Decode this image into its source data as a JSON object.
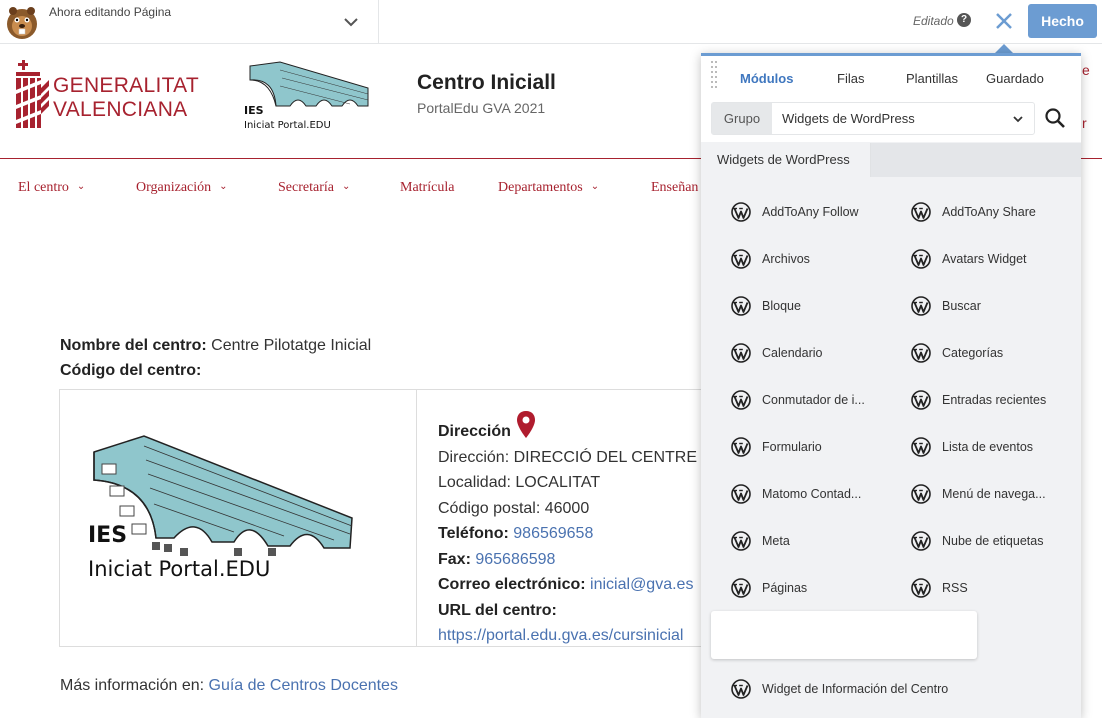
{
  "builder": {
    "editing_label": "Ahora editando Página",
    "status_label": "Editado",
    "help_icon": "help-icon",
    "close_icon": "close-icon",
    "done_label": "Hecho"
  },
  "site": {
    "org_name_line1": "GENERALITAT",
    "org_name_line2": "VALENCIANA",
    "title": "Centro Iniciall",
    "tagline": "PortalEdu GVA 2021",
    "logo_text_line1": "IES",
    "logo_text_line2": "Iniciat Portal.EDU",
    "right_edge_1": "e",
    "right_edge_2": "r"
  },
  "nav": {
    "items": [
      {
        "label": "El centro",
        "caret": true
      },
      {
        "label": "Organización",
        "caret": true
      },
      {
        "label": "Secretaría",
        "caret": true
      },
      {
        "label": "Matrícula",
        "caret": false
      },
      {
        "label": "Departamentos",
        "caret": true
      },
      {
        "label": "Enseñan",
        "caret": false
      }
    ]
  },
  "content": {
    "center_name_label": "Nombre del centro:",
    "center_name_value": "Centre Pilotatge Inicial",
    "center_code_label": "Código del centro:",
    "address_heading": "Dirección",
    "address_line": "Dirección: DIRECCIÓ DEL CENTRE",
    "locality_line": "Localidad: LOCALITAT",
    "postal_line": "Código postal: 46000",
    "phone_label": "Teléfono:",
    "phone_value": "986569658",
    "fax_label": "Fax:",
    "fax_value": "965686598",
    "email_label": "Correo electrónico:",
    "email_value": "inicial@gva.es",
    "url_label": "URL del centro:",
    "url_value": "https://portal.edu.gva.es/cursinicial",
    "more_info_label": "Más información en:",
    "more_info_link": "Guía de Centros Docentes"
  },
  "panel": {
    "tabs": [
      "Módulos",
      "Filas",
      "Plantillas",
      "Guardado"
    ],
    "active_tab": "Módulos",
    "group_label": "Grupo",
    "group_value": "Widgets de WordPress",
    "section_title": "Widgets de WordPress",
    "widgets": [
      "AddToAny Follow",
      "AddToAny Share",
      "Archivos",
      "Avatars Widget",
      "Bloque",
      "Buscar",
      "Calendario",
      "Categorías",
      "Conmutador de i...",
      "Entradas recientes",
      "Formulario",
      "Lista de eventos",
      "Matomo Contad...",
      "Menú de navega...",
      "Meta",
      "Nube de etiquetas",
      "Páginas",
      "RSS",
      "Widget de Información del Centro"
    ],
    "accent_color": "#6c9cd2",
    "active_tab_color": "#3f77bf"
  },
  "colors": {
    "brand_red": "#a7222f",
    "link_blue": "#4a72b0"
  }
}
